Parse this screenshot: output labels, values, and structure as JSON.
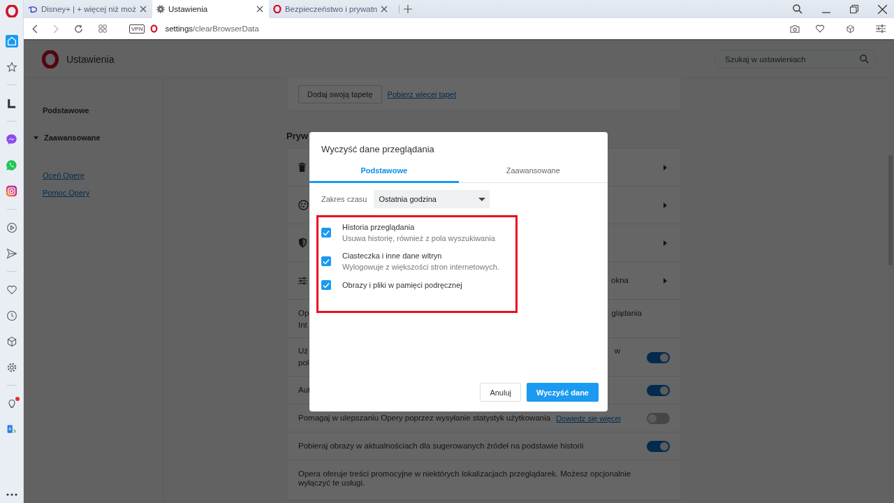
{
  "browser_tabs": [
    {
      "kind": "site",
      "title": "Disney+ | + więcej niż moż",
      "selected": false
    },
    {
      "kind": "settings",
      "title": "Ustawienia",
      "selected": true
    },
    {
      "kind": "opera",
      "title": "Bezpieczeństwo i prywatn",
      "selected": false
    }
  ],
  "address_bar": {
    "badge": "VPN",
    "host": "settings",
    "path": "/clearBrowserData"
  },
  "sidebar_items": [
    {
      "kind": "home",
      "selected": true,
      "notification": false
    },
    {
      "kind": "star",
      "selected": false,
      "notification": false
    },
    {
      "kind": "sep"
    },
    {
      "kind": "l",
      "selected": false,
      "notification": false
    },
    {
      "kind": "sep"
    },
    {
      "kind": "messenger",
      "selected": false,
      "notification": false
    },
    {
      "kind": "whatsapp",
      "selected": false,
      "notification": false
    },
    {
      "kind": "instagram",
      "selected": false,
      "notification": false
    },
    {
      "kind": "sep"
    },
    {
      "kind": "play",
      "selected": false,
      "notification": false
    },
    {
      "kind": "send",
      "selected": false,
      "notification": false
    },
    {
      "kind": "sep"
    },
    {
      "kind": "heart",
      "selected": false,
      "notification": false
    },
    {
      "kind": "clock",
      "selected": false,
      "notification": false
    },
    {
      "kind": "cube",
      "selected": false,
      "notification": false
    },
    {
      "kind": "gear",
      "selected": false,
      "notification": false
    },
    {
      "kind": "sep"
    },
    {
      "kind": "bulb",
      "selected": false,
      "notification": true
    },
    {
      "kind": "translate",
      "selected": false,
      "notification": false
    }
  ],
  "settings": {
    "title": "Ustawienia",
    "search": {
      "placeholder": "Szukaj w ustawieniach"
    },
    "nav": [
      {
        "kind": "section",
        "label": "Podstawowe"
      },
      {
        "kind": "expandable",
        "label": "Zaawansowane",
        "expanded": true
      },
      {
        "kind": "link",
        "label": "Oceń Operę"
      },
      {
        "kind": "link",
        "label": "Pomoc Opery"
      }
    ],
    "wallpaper_card": {
      "button": "Dodaj swoją tapetę",
      "link": "Pobierz więcej tapet"
    },
    "privacy_section": {
      "title": "Pryw",
      "rows": [
        {
          "kind": "nav"
        },
        {
          "kind": "nav"
        },
        {
          "kind": "nav"
        },
        {
          "kind": "nav",
          "right": "okna"
        },
        {
          "kind": "text",
          "left": [
            "Op",
            "Int"
          ],
          "right": "glądania"
        },
        {
          "kind": "toggle",
          "left": [
            "Uż",
            "pol"
          ],
          "right": "w",
          "on": true
        },
        {
          "kind": "toggle",
          "left": [
            "Aut"
          ],
          "on": true
        },
        {
          "kind": "toggle",
          "left": [
            "Pomagaj w ulepszaniu Opery poprzez wysyłanie statystyk użytkowania"
          ],
          "link": "Dowiedz się więcej",
          "on": false
        },
        {
          "kind": "toggle",
          "left": [
            "Pobieraj obrazy w aktualnościach dla sugerowanych źródeł na podstawie historii"
          ],
          "on": true
        },
        {
          "kind": "text",
          "left": [
            "Opera oferuje treści promocyjne w niektórych lokalizacjach przeglądarek. Możesz opcjonalnie wyłączyć te usługi."
          ]
        }
      ]
    }
  },
  "dialog": {
    "title": "Wyczyść dane przeglądania",
    "tabs": [
      {
        "label": "Podstawowe",
        "selected": true
      },
      {
        "label": "Zaawansowane",
        "selected": false
      }
    ],
    "time_range": {
      "label": "Zakres czasu",
      "value": "Ostatnia godzina"
    },
    "options": [
      {
        "label": "Historia przeglądania",
        "description": "Usuwa historię, również z pola wyszukiwania",
        "checked": true
      },
      {
        "label": "Ciasteczka i inne dane witryn",
        "description": "Wylogowuje z większości stron internetowych.",
        "checked": true
      },
      {
        "label": "Obrazy i pliki w pamięci podręcznej",
        "checked": true
      }
    ],
    "buttons": [
      {
        "kind": "secondary",
        "label": "Anuluj"
      },
      {
        "kind": "primary",
        "label": "Wyczyść dane"
      }
    ]
  }
}
